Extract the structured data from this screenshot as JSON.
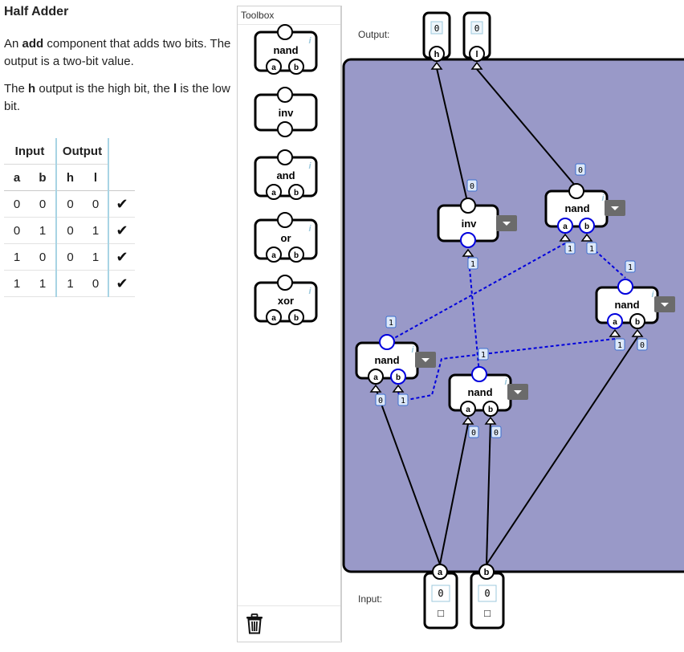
{
  "description": {
    "title": "Half Adder",
    "para1_pre": "An ",
    "para1_bold": "add",
    "para1_post": " component that adds two bits. The output is a two-bit value.",
    "para2_pre": "The ",
    "para2_bold1": "h",
    "para2_mid": " output is the high bit, the ",
    "para2_bold2": "l",
    "para2_post": " is the low bit."
  },
  "truth_table": {
    "group_input": "Input",
    "group_output": "Output",
    "col_a": "a",
    "col_b": "b",
    "col_h": "h",
    "col_l": "l",
    "rows": [
      {
        "a": "0",
        "b": "0",
        "h": "0",
        "l": "0",
        "mark": "✔"
      },
      {
        "a": "0",
        "b": "1",
        "h": "0",
        "l": "1",
        "mark": "✔"
      },
      {
        "a": "1",
        "b": "0",
        "h": "0",
        "l": "1",
        "mark": "✔"
      },
      {
        "a": "1",
        "b": "1",
        "h": "1",
        "l": "0",
        "mark": "✔"
      }
    ]
  },
  "toolbox": {
    "title": "Toolbox",
    "items": [
      {
        "label": "nand",
        "pins": [
          "a",
          "b"
        ]
      },
      {
        "label": "inv",
        "pins": []
      },
      {
        "label": "and",
        "pins": [
          "a",
          "b"
        ]
      },
      {
        "label": "or",
        "pins": [
          "a",
          "b"
        ]
      },
      {
        "label": "xor",
        "pins": [
          "a",
          "b"
        ]
      }
    ],
    "info_glyph": "i"
  },
  "workspace": {
    "output_label": "Output:",
    "input_label": "Input:",
    "colors": {
      "canvas": "#9999c8",
      "active_wire": "#0000dd",
      "wire": "#000000",
      "value_badge": "#dde8f8",
      "menu_button": "#6b6b6b"
    },
    "outputs": [
      {
        "pin": "h",
        "value": "0"
      },
      {
        "pin": "l",
        "value": "0"
      }
    ],
    "inputs": [
      {
        "pin": "a",
        "value": "0",
        "toggle": "□"
      },
      {
        "pin": "b",
        "value": "0",
        "toggle": "□"
      }
    ],
    "gates": [
      {
        "id": "inv",
        "label": "inv",
        "pins": [],
        "out_value": "0",
        "in_value": "1"
      },
      {
        "id": "nand-top",
        "label": "nand",
        "pins": [
          "a",
          "b"
        ],
        "out_value": "0",
        "in_values": [
          "1",
          "1"
        ]
      },
      {
        "id": "nand-right",
        "label": "nand",
        "pins": [
          "a",
          "b"
        ],
        "out_value": "1",
        "in_values": [
          "1",
          "0"
        ]
      },
      {
        "id": "nand-left",
        "label": "nand",
        "pins": [
          "a",
          "b"
        ],
        "out_value": "1",
        "in_values": [
          "0",
          "1"
        ]
      },
      {
        "id": "nand-mid",
        "label": "nand",
        "pins": [
          "a",
          "b"
        ],
        "out_value": "1",
        "in_values": [
          "0",
          "0"
        ]
      }
    ]
  }
}
